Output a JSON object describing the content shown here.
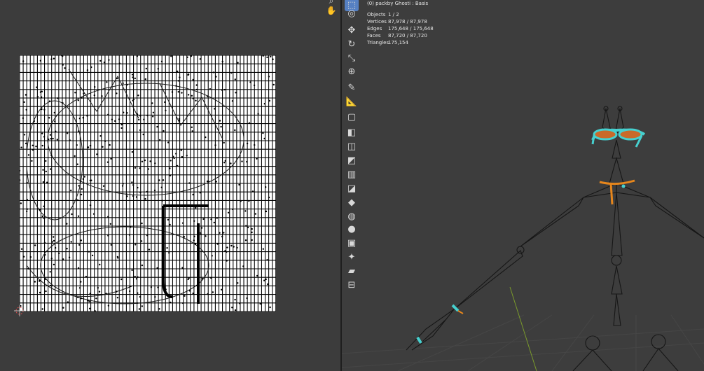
{
  "viewport": {
    "object_title": "(0) packby Ghosti : Basis",
    "stats": [
      {
        "label": "Objects",
        "value": "1 / 2"
      },
      {
        "label": "Vertices",
        "value": "87,978 / 87,978"
      },
      {
        "label": "Edges",
        "value": "175,648 / 175,648"
      },
      {
        "label": "Faces",
        "value": "87,720 / 87,720"
      },
      {
        "label": "Triangles",
        "value": "175,154"
      }
    ]
  },
  "toolbar": {
    "tools": [
      {
        "name": "select-box-tool",
        "glyph": "⬚",
        "active": true
      },
      {
        "name": "cursor-tool",
        "glyph": "◎"
      },
      {
        "name": "move-tool",
        "glyph": "✥"
      },
      {
        "name": "rotate-tool",
        "glyph": "↻"
      },
      {
        "name": "scale-tool",
        "glyph": "⤡"
      },
      {
        "name": "transform-tool",
        "glyph": "⊕"
      },
      {
        "name": "annotate-tool",
        "glyph": "✎"
      },
      {
        "name": "measure-tool",
        "glyph": "📐"
      },
      {
        "name": "add-cube-tool",
        "glyph": "▢"
      },
      {
        "name": "extrude-region-tool",
        "glyph": "◧"
      },
      {
        "name": "inset-faces-tool",
        "glyph": "◫"
      },
      {
        "name": "bevel-tool",
        "glyph": "◩"
      },
      {
        "name": "loop-cut-tool",
        "glyph": "▥"
      },
      {
        "name": "knife-tool",
        "glyph": "◪"
      },
      {
        "name": "poly-build-tool",
        "glyph": "◆"
      },
      {
        "name": "spin-tool",
        "glyph": "◍"
      },
      {
        "name": "smooth-tool",
        "glyph": "●"
      },
      {
        "name": "edge-slide-tool",
        "glyph": "▣"
      },
      {
        "name": "shrink-fatten-tool",
        "glyph": "✦"
      },
      {
        "name": "shear-tool",
        "glyph": "▰"
      },
      {
        "name": "rip-region-tool",
        "glyph": "⊟"
      }
    ]
  },
  "uv_editor": {
    "nav": [
      {
        "name": "zoom-icon",
        "glyph": "⌕"
      },
      {
        "name": "hand-pan-icon",
        "glyph": "✋"
      }
    ]
  },
  "colors": {
    "armature_bone": "#161616",
    "glasses_selected": "#46d0cf",
    "glasses_lens": "#c96a2a",
    "bowtie_active": "#e6861c",
    "grid_y_axis": "#7a9a2c"
  }
}
